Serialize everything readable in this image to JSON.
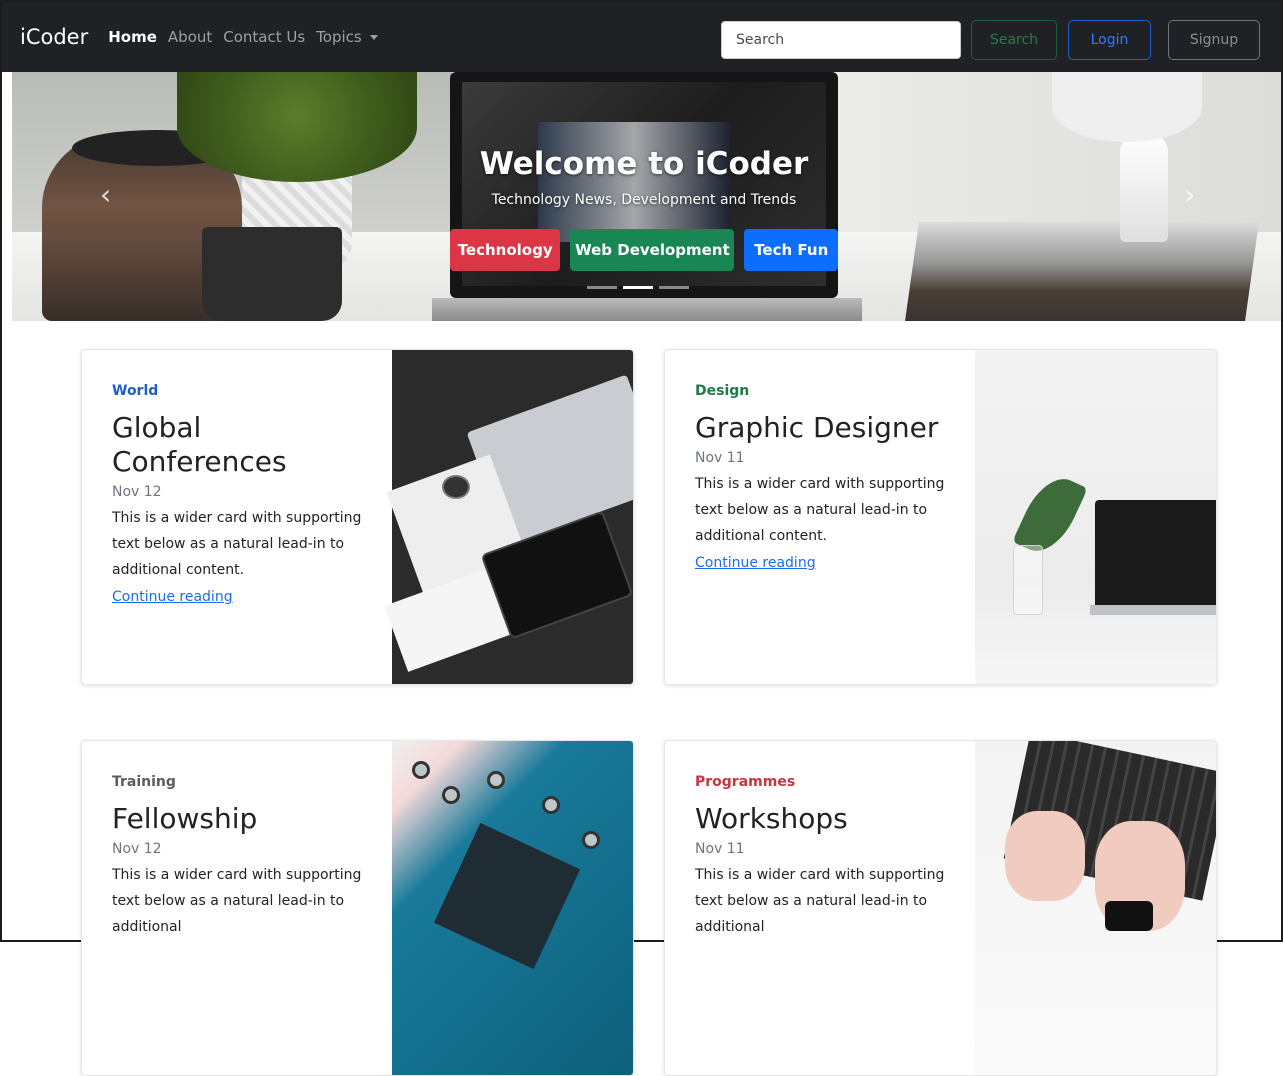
{
  "navbar": {
    "brand": "iCoder",
    "links": [
      {
        "label": "Home"
      },
      {
        "label": "About"
      },
      {
        "label": "Contact Us"
      },
      {
        "label": "Topics"
      }
    ],
    "search_placeholder": "Search",
    "search_button": "Search",
    "login_button": "Login",
    "signup_button": "Signup"
  },
  "hero": {
    "title": "Welcome to iCoder",
    "subtitle": "Technology News, Development and Trends",
    "buttons": [
      {
        "label": "Technology",
        "color": "#dc3545"
      },
      {
        "label": "Web Development",
        "color": "#198754"
      },
      {
        "label": "Tech Fun",
        "color": "#0d6efd"
      }
    ],
    "active_slide": 2,
    "slide_count": 3
  },
  "cards": [
    {
      "category": "World",
      "category_color": "#1f5ec8",
      "title": "Global Conferences",
      "date": "Nov 12",
      "text": "This is a wider card with supporting text below as a natural lead-in to additional content.",
      "link": "Continue reading"
    },
    {
      "category": "Design",
      "category_color": "#1e7a4a",
      "title": "Graphic Designer",
      "date": "Nov 11",
      "text": "This is a wider card with supporting text below as a natural lead-in to additional content.",
      "link": "Continue reading"
    },
    {
      "category": "Training",
      "category_color": "#5c5c5c",
      "title": "Fellowship",
      "date": "Nov 12",
      "text": "This is a wider card with supporting text below as a natural lead-in to additional",
      "link": ""
    },
    {
      "category": "Programmes",
      "category_color": "#c8343f",
      "title": "Workshops",
      "date": "Nov 11",
      "text": "This is a wider card with supporting text below as a natural lead-in to additional",
      "link": ""
    }
  ]
}
